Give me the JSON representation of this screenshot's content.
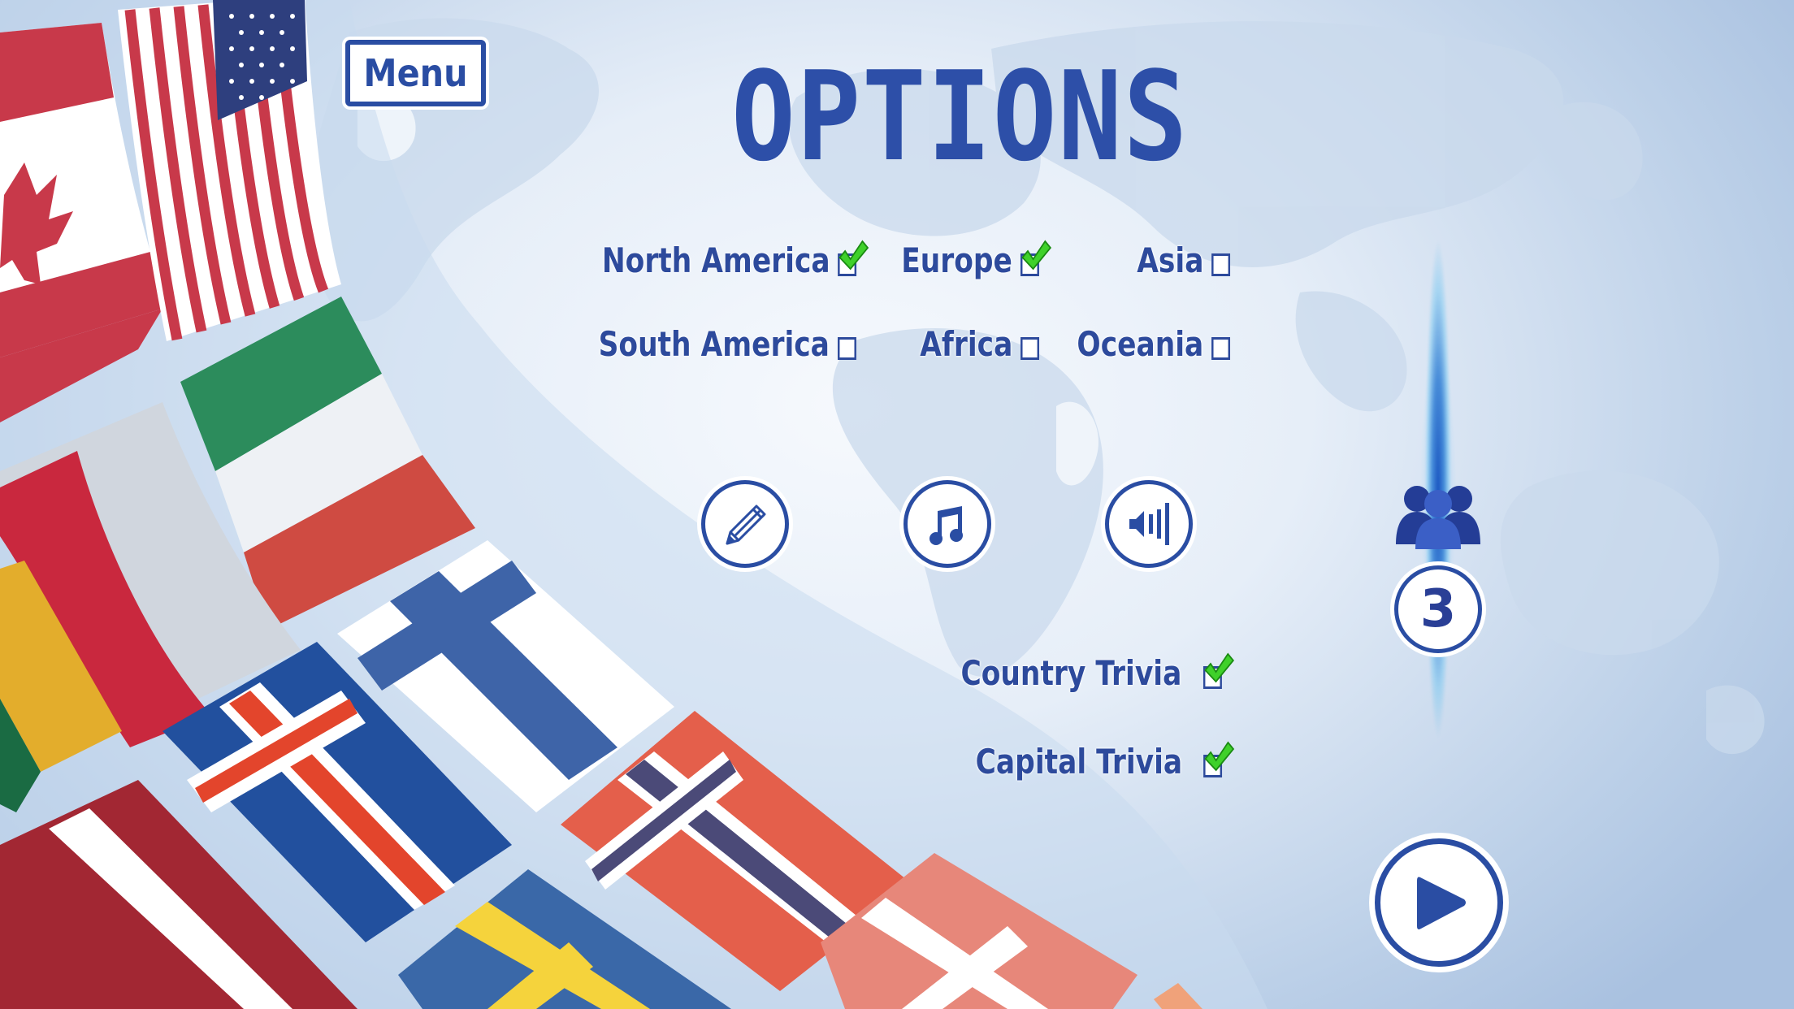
{
  "screen": {
    "title": "OPTIONS",
    "menu_button": {
      "label": "Menu"
    }
  },
  "regions": [
    {
      "label": "North America",
      "checked": true
    },
    {
      "label": "Europe",
      "checked": true
    },
    {
      "label": "Asia",
      "checked": false
    },
    {
      "label": "South America",
      "checked": false
    },
    {
      "label": "Africa",
      "checked": false
    },
    {
      "label": "Oceania",
      "checked": false
    }
  ],
  "settings_buttons": [
    {
      "icon": "pencil-icon",
      "name": "edit-settings-button"
    },
    {
      "icon": "music-note-icon",
      "name": "music-toggle-button"
    },
    {
      "icon": "volume-icon",
      "name": "sound-toggle-button"
    }
  ],
  "players": {
    "icon": "players-group-icon",
    "count": "3"
  },
  "trivia": [
    {
      "label": "Country Trivia",
      "checked": true
    },
    {
      "label": "Capital Trivia",
      "checked": true
    }
  ],
  "play_button": {
    "icon": "play-icon"
  },
  "colors": {
    "primary_blue": "#2a4da3",
    "check_green": "#3fd12a",
    "background_light": "#eef3fa",
    "background_edge": "#a9c1e0"
  },
  "decorations": {
    "flag_band": [
      "Canada",
      "United States",
      "Italy",
      "Poland",
      "Lithuania",
      "Finland",
      "Iceland",
      "Latvia",
      "Norway",
      "Sweden",
      "Denmark"
    ]
  }
}
